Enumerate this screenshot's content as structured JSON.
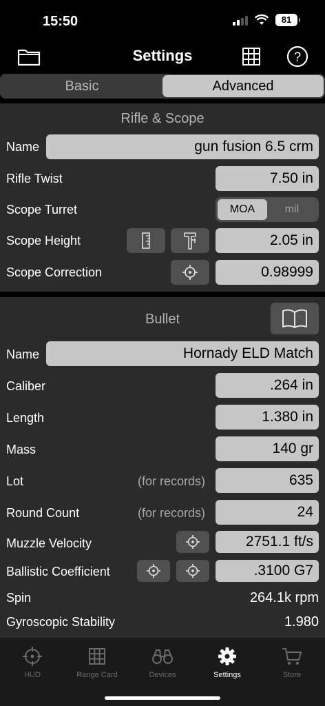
{
  "status": {
    "time": "15:50",
    "battery": "81"
  },
  "nav": {
    "title": "Settings"
  },
  "segments": {
    "basic": "Basic",
    "advanced": "Advanced"
  },
  "rifle": {
    "title": "Rifle & Scope",
    "name_label": "Name",
    "name_value": "gun fusion 6.5 crm",
    "twist_label": "Rifle Twist",
    "twist_value": "7.50 in",
    "turret_label": "Scope Turret",
    "turret_moa": "MOA",
    "turret_mil": "mil",
    "height_label": "Scope Height",
    "height_value": "2.05 in",
    "correction_label": "Scope Correction",
    "correction_value": "0.98999"
  },
  "bullet": {
    "title": "Bullet",
    "name_label": "Name",
    "name_value": "Hornady ELD Match",
    "caliber_label": "Caliber",
    "caliber_value": ".264 in",
    "length_label": "Length",
    "length_value": "1.380 in",
    "mass_label": "Mass",
    "mass_value": "140 gr",
    "lot_label": "Lot",
    "lot_note": "(for records)",
    "lot_value": "635",
    "count_label": "Round Count",
    "count_note": "(for records)",
    "count_value": "24",
    "velocity_label": "Muzzle Velocity",
    "velocity_value": "2751.1 ft/s",
    "bc_label": "Ballistic Coefficient",
    "bc_value": ".3100 G7",
    "spin_label": "Spin",
    "spin_value": "264.1k rpm",
    "stability_label": "Gyroscopic Stability",
    "stability_value": "1.980"
  },
  "tabs": {
    "hud": "HUD",
    "range_card": "Range Card",
    "devices": "Devices",
    "settings": "Settings",
    "store": "Store"
  },
  "colors": {
    "field": "#c6c6c6",
    "section": "#2b2b2b",
    "button": "#505050"
  }
}
